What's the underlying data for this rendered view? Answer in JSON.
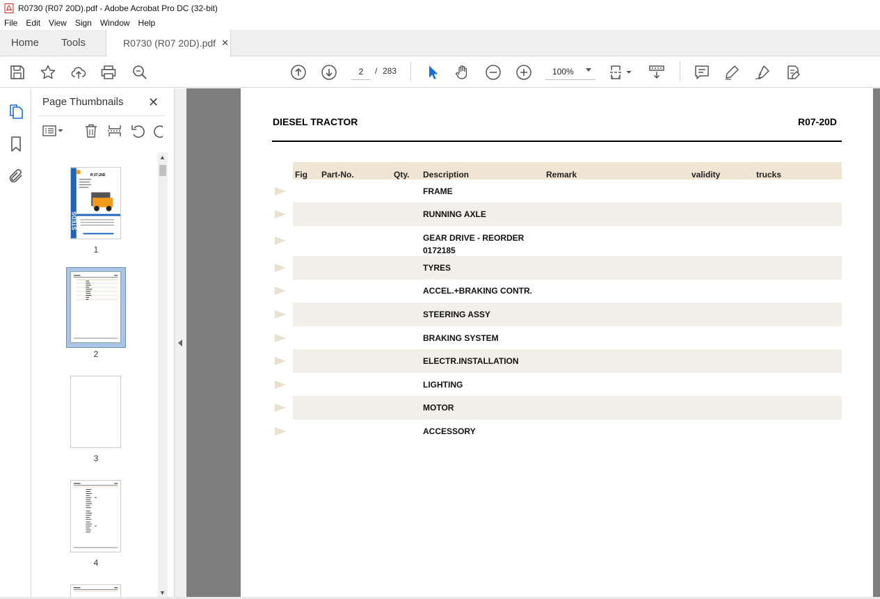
{
  "window": {
    "title": "R0730 (R07 20D).pdf - Adobe Acrobat Pro DC (32-bit)"
  },
  "menu": [
    "File",
    "Edit",
    "View",
    "Sign",
    "Window",
    "Help"
  ],
  "tabs": {
    "home": "Home",
    "tools": "Tools",
    "document": "R0730 (R07 20D).pdf"
  },
  "toolbar": {
    "current_page": "2",
    "page_separator": "/",
    "total_pages": "283",
    "zoom": "100%"
  },
  "thumbnails": {
    "title": "Page Thumbnails",
    "pages": [
      {
        "num": "1",
        "selected": false
      },
      {
        "num": "2",
        "selected": true
      },
      {
        "num": "3",
        "selected": false
      },
      {
        "num": "4",
        "selected": false
      }
    ]
  },
  "document": {
    "title_left": "DIESEL TRACTOR",
    "title_right": "R07-20D",
    "headers": {
      "fig": "Fig",
      "part_no": "Part-No.",
      "qty": "Qty.",
      "description": "Description",
      "remark": "Remark",
      "validity": "validity",
      "trucks": "trucks"
    },
    "rows": [
      {
        "description": "FRAME"
      },
      {
        "description": "RUNNING AXLE"
      },
      {
        "description": "GEAR DRIVE - REORDER",
        "description2": "0172185"
      },
      {
        "description": "TYRES"
      },
      {
        "description": "ACCEL.+BRAKING CONTR."
      },
      {
        "description": "STEERING ASSY"
      },
      {
        "description": "BRAKING SYSTEM"
      },
      {
        "description": "ELECTR.INSTALLATION"
      },
      {
        "description": "LIGHTING"
      },
      {
        "description": "MOTOR"
      },
      {
        "description": "ACCESSORY"
      }
    ]
  },
  "thumb1": {
    "heading": "R 07-20D",
    "brand": "STEDS"
  },
  "colors": {
    "header_bar": "#efe5d2",
    "row_shade": "#f2efe8",
    "row_arrow": "#e9e1cd",
    "selection": "#a9c4e4",
    "doc_background": "#7f7f7f",
    "cursor_blue": "#1a6fd6",
    "pdf_red": "#d7261e"
  }
}
